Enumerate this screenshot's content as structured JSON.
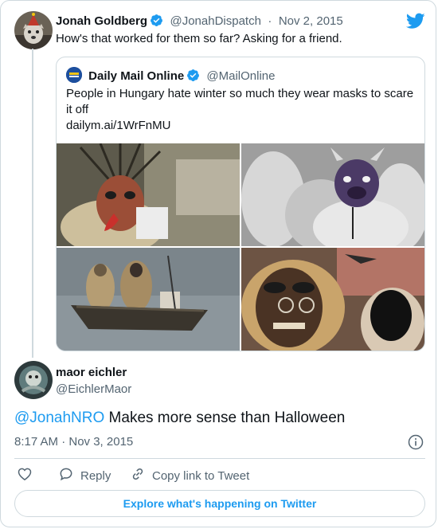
{
  "colors": {
    "accent": "#1d9bf0",
    "muted": "#536471",
    "border": "#cfd9de",
    "text": "#0f1419"
  },
  "main_tweet": {
    "author_name": "Jonah Goldberg",
    "author_handle": "@JonahDispatch",
    "separator": "·",
    "date": "Nov 2, 2015",
    "text": "How's that worked for them so far? Asking for a friend.",
    "avatar_icon": "avatar-jonah-icon",
    "brand_icon": "twitter-bird-icon"
  },
  "quoted_tweet": {
    "author_name": "Daily Mail Online",
    "author_handle": "@MailOnline",
    "text": "People in Hungary hate winter so much they wear masks to scare it off",
    "link": "dailym.ai/1WrFnMU",
    "photos": [
      "mask-photo-1",
      "mask-photo-2",
      "boat-photo",
      "mask-photo-4"
    ]
  },
  "reply_tweet": {
    "author_name": "maor eichler",
    "author_handle": "@EichlerMaor",
    "mention": "@JonahNRO",
    "text": " Makes more sense than Halloween",
    "timestamp": "8:17 AM · Nov 3, 2015"
  },
  "actions": {
    "reply_label": "Reply",
    "copy_label": "Copy link to Tweet"
  },
  "footer": {
    "explore_label": "Explore what's happening on Twitter"
  }
}
